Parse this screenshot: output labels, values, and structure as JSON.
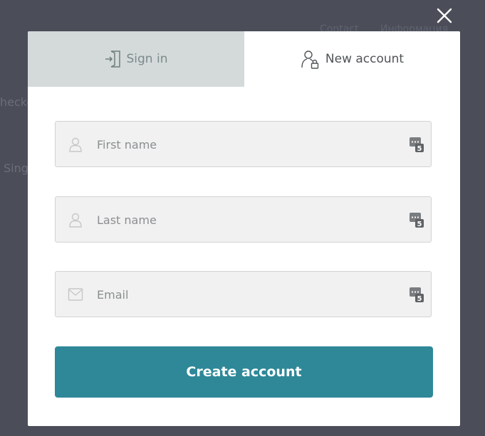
{
  "background": {
    "nav": [
      "Contact",
      "Информация"
    ],
    "side_text": [
      "hecko",
      "Sing"
    ]
  },
  "close_icon": "close-icon",
  "tabs": [
    {
      "label": "Sign in",
      "icon": "sign-in-icon",
      "active": false
    },
    {
      "label": "New account",
      "icon": "user-lock-icon",
      "active": true
    }
  ],
  "form": {
    "fields": [
      {
        "placeholder": "First name",
        "value": "",
        "icon": "user-icon"
      },
      {
        "placeholder": "Last name",
        "value": "",
        "icon": "user-icon"
      },
      {
        "placeholder": "Email",
        "value": "",
        "icon": "envelope-icon"
      }
    ],
    "submit_label": "Create account"
  },
  "colors": {
    "overlay": "#4b4e58",
    "accent": "#2e8898",
    "inactive_tab": "#d4dada"
  }
}
